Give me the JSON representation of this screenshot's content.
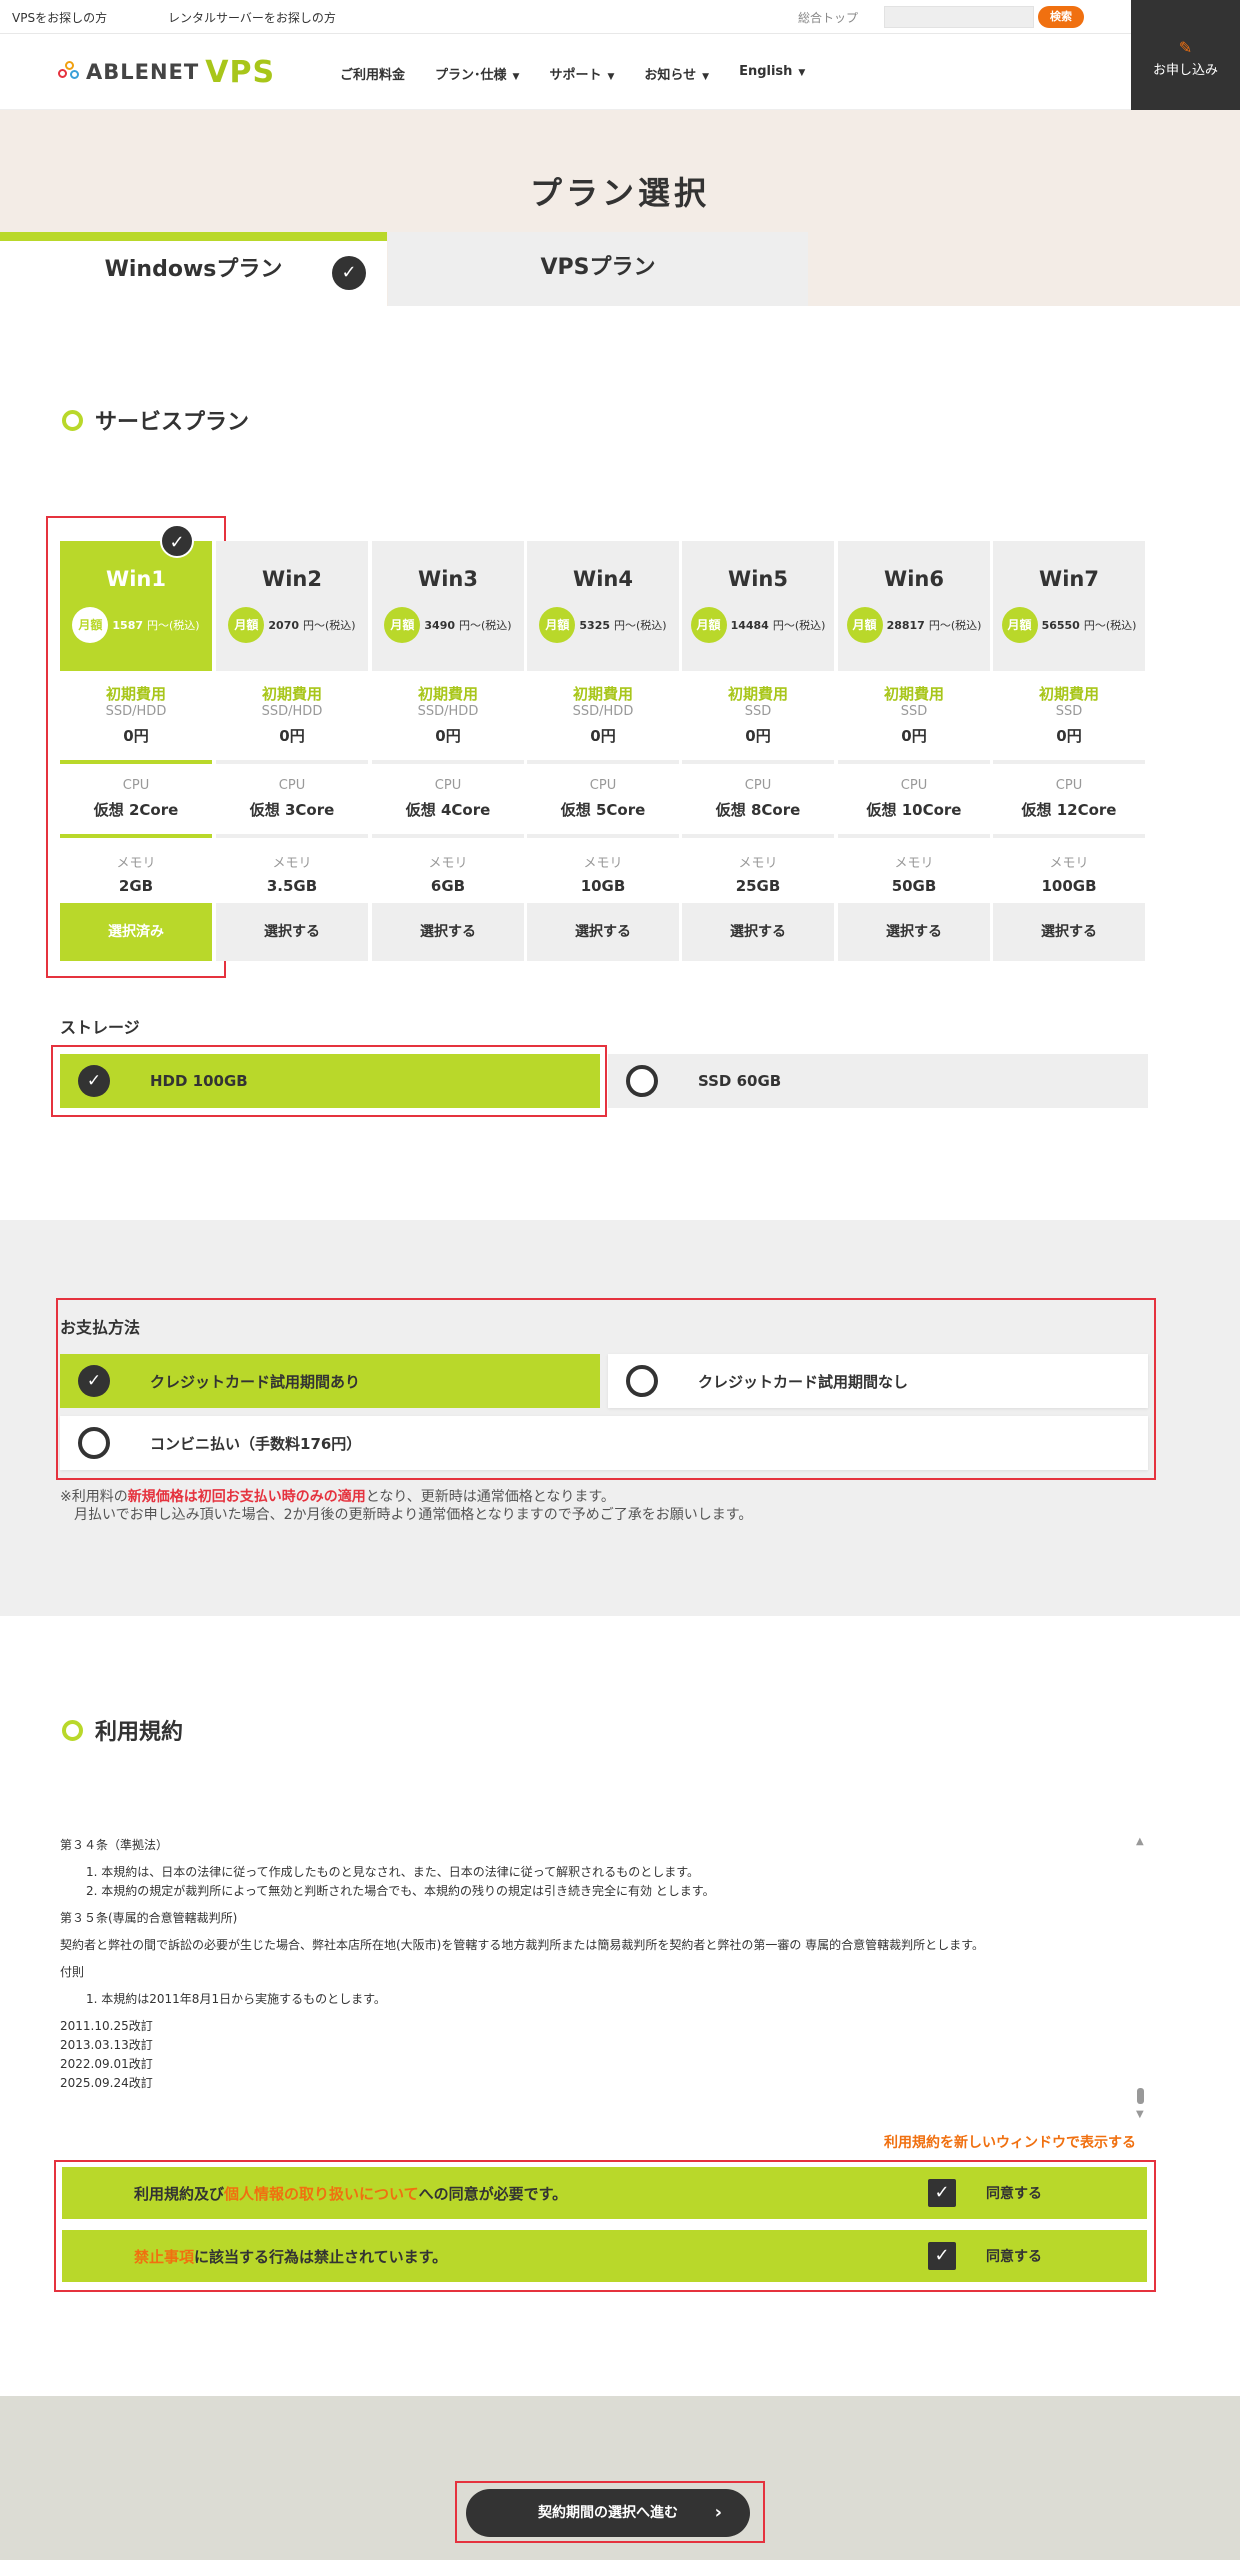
{
  "topbar": {
    "link1": "VPSをお探しの方",
    "link2": "レンタルサーバーをお探しの方",
    "link3": "総合トップ",
    "search_button": "検索"
  },
  "header": {
    "logo_text": "ABLENET",
    "logo_vps": "VPS",
    "nav": [
      "ご利用料金",
      "プラン･仕様",
      "サポート",
      "お知らせ",
      "English"
    ],
    "apply": "お申し込み"
  },
  "hero": {
    "title": "プラン選択",
    "tab_windows": "Windowsプラン",
    "tab_vps": "VPSプラン"
  },
  "service_plan": {
    "heading": "サービスプラン",
    "monthly_badge": "月額",
    "price_suffix": "円〜(税込)",
    "initial_label": "初期費用",
    "cpu_label": "CPU",
    "memory_label": "メモリ",
    "plans": [
      {
        "name": "Win1",
        "price": "1587",
        "disk": "SSD/HDD",
        "initial": "0円",
        "cpu": "仮想 2Core",
        "memory": "2GB",
        "button": "選択済み",
        "selected": true
      },
      {
        "name": "Win2",
        "price": "2070",
        "disk": "SSD/HDD",
        "initial": "0円",
        "cpu": "仮想 3Core",
        "memory": "3.5GB",
        "button": "選択する",
        "selected": false
      },
      {
        "name": "Win3",
        "price": "3490",
        "disk": "SSD/HDD",
        "initial": "0円",
        "cpu": "仮想 4Core",
        "memory": "6GB",
        "button": "選択する",
        "selected": false
      },
      {
        "name": "Win4",
        "price": "5325",
        "disk": "SSD/HDD",
        "initial": "0円",
        "cpu": "仮想 5Core",
        "memory": "10GB",
        "button": "選択する",
        "selected": false
      },
      {
        "name": "Win5",
        "price": "14484",
        "disk": "SSD",
        "initial": "0円",
        "cpu": "仮想 8Core",
        "memory": "25GB",
        "button": "選択する",
        "selected": false
      },
      {
        "name": "Win6",
        "price": "28817",
        "disk": "SSD",
        "initial": "0円",
        "cpu": "仮想 10Core",
        "memory": "50GB",
        "button": "選択する",
        "selected": false
      },
      {
        "name": "Win7",
        "price": "56550",
        "disk": "SSD",
        "initial": "0円",
        "cpu": "仮想 12Core",
        "memory": "100GB",
        "button": "選択する",
        "selected": false
      }
    ]
  },
  "storage": {
    "label": "ストレージ",
    "option1": "HDD 100GB",
    "option2": "SSD 60GB"
  },
  "payment": {
    "label": "お支払方法",
    "option1": "クレジットカード試用期間あり",
    "option2": "クレジットカード試用期間なし",
    "option3": "コンビニ払い（手数料176円）",
    "note_pre": "※利用料の",
    "note_hl": "新規価格は初回お支払い時のみの適用",
    "note_post": "となり、更新時は通常価格となります。",
    "note_line2": "月払いでお申し込み頂いた場合、2か月後の更新時より通常価格となりますので予めご了承をお願いします。"
  },
  "terms": {
    "heading": "利用規約",
    "art34": "第３４条（準拠法）",
    "art34_1": "1. 本規約は、日本の法律に従って作成したものと見なされ、また、日本の法律に従って解釈されるものとします。",
    "art34_2": "2. 本規約の規定が裁判所によって無効と判断された場合でも、本規約の残りの規定は引き続き完全に有効 とします。",
    "art35": "第３５条(専属的合意管轄裁判所)",
    "art35_body": "契約者と弊社の間で訴訟の必要が生じた場合、弊社本店所在地(大阪市)を管轄する地方裁判所または簡易裁判所を契約者と弊社の第一審の 専属的合意管轄裁判所とします。",
    "appendix": "付則",
    "appendix_1": "1. 本規約は2011年8月1日から実施するものとします。",
    "rev1": "2011.10.25改訂",
    "rev2": "2013.03.13改訂",
    "rev3": "2022.09.01改訂",
    "rev4": "2025.09.24改訂",
    "new_window": "利用規約を新しいウィンドウで表示する"
  },
  "agreements": {
    "row1_pre": "利用規約及び",
    "row1_link": "個人情報の取り扱いについて",
    "row1_post": "への同意が必要です。",
    "row2_link": "禁止事項",
    "row2_post": "に該当する行為は禁止されています。",
    "agree_label": "同意する"
  },
  "footer": {
    "next_button": "契約期間の選択へ進む"
  }
}
